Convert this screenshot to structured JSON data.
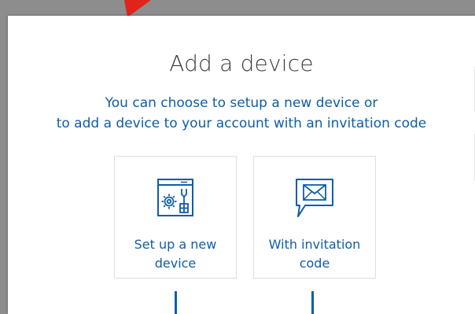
{
  "dialog": {
    "title": "Add a device",
    "subtitle_line1": "You can choose to setup a new device or",
    "subtitle_line2": "to add a device to your account with an invitation code"
  },
  "options": [
    {
      "label_line1": "Set up a new",
      "label_line2": "device",
      "icon": "device-setup-icon"
    },
    {
      "label_line1": "With invitation",
      "label_line2": "code",
      "icon": "invitation-message-icon"
    }
  ],
  "colors": {
    "accent": "#0f5da8",
    "title_text": "#3c3c3c",
    "overlay": "#8d8d8d",
    "annotation_arrow": "#e0241b"
  }
}
